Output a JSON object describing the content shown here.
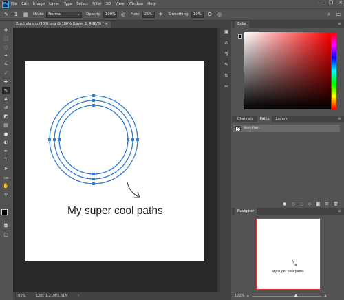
{
  "app": {
    "logo": "Ps",
    "menu": [
      "File",
      "Edit",
      "Image",
      "Layer",
      "Type",
      "Select",
      "Filter",
      "3D",
      "View",
      "Window",
      "Help"
    ],
    "window_controls": [
      "—",
      "❐",
      "✕"
    ]
  },
  "options_bar": {
    "brush_size": "1",
    "mode_label": "Mode:",
    "mode_value": "Normal",
    "opacity_label": "Opacity:",
    "opacity_value": "100%",
    "flow_label": "Flow:",
    "flow_value": "25%",
    "smoothing_label": "Smoothing:",
    "smoothing_value": "10%"
  },
  "document": {
    "tab_title": "Zrzut ekranu (100).png @ 100% (Layer 2, RGB/8) *",
    "canvas_text": "My super cool paths",
    "status_zoom": "100%",
    "status_doc": "Doc: 1,21M/5,61M"
  },
  "panels": {
    "color": {
      "title": "Color"
    },
    "paths": {
      "tabs": [
        "Channels",
        "Paths",
        "Layers"
      ],
      "active_tab": "Paths",
      "items": [
        {
          "name": "Work Path"
        }
      ]
    },
    "navigator": {
      "title": "Navigator",
      "preview_text": "My super cool paths",
      "zoom": "100%"
    }
  },
  "colors": {
    "accent": "#31a8ff",
    "path_stroke": "#2f7bd3",
    "foreground": "#000000",
    "background": "#ffffff",
    "navigator_frame": "#e03030"
  }
}
